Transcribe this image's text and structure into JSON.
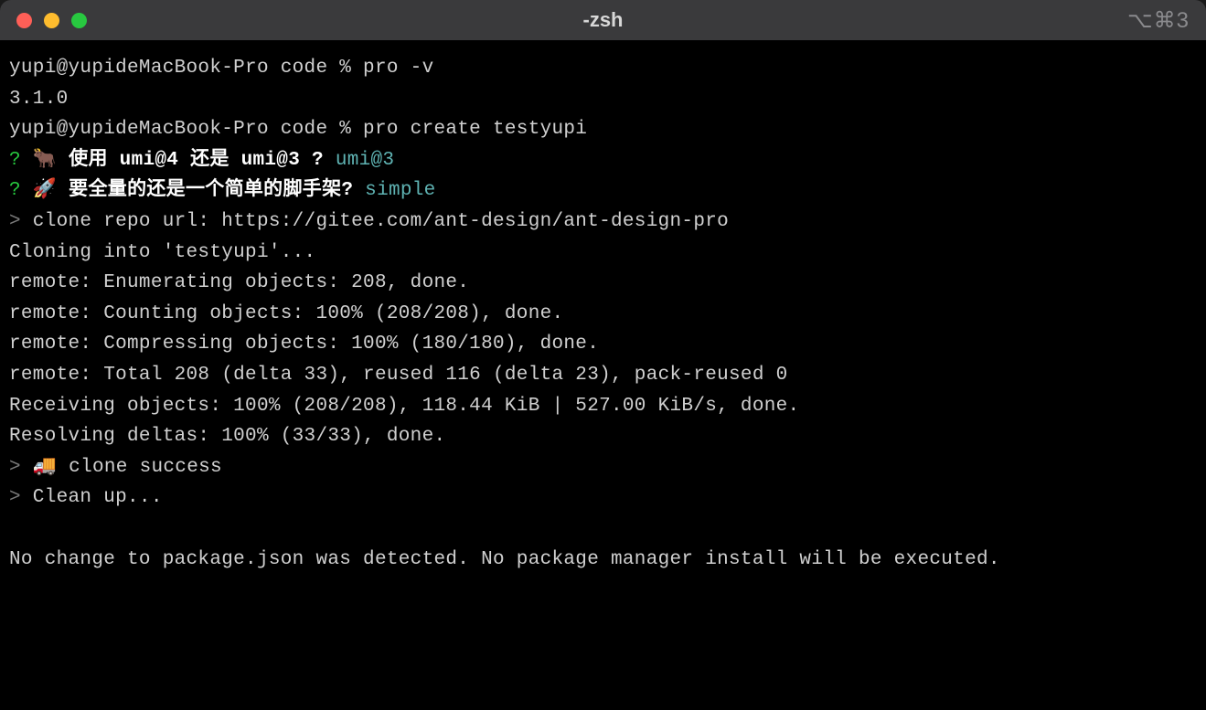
{
  "titlebar": {
    "title": "-zsh",
    "shortcut": "⌥⌘3"
  },
  "lines": {
    "l0": "yupi@yupideMacBook-Pro code % pro -v",
    "l1": "3.1.0",
    "l2": "yupi@yupideMacBook-Pro code % pro create testyupi",
    "q1_mark": "?",
    "q1_emoji": "🐂",
    "q1_text": " 使用 umi@4 还是 umi@3 ? ",
    "q1_answer": "umi@3",
    "q2_mark": "?",
    "q2_emoji": "🚀",
    "q2_text": " 要全量的还是一个简单的脚手架? ",
    "q2_answer": "simple",
    "l5_gt": ">",
    "l5": " clone repo url: https://gitee.com/ant-design/ant-design-pro",
    "l6": "Cloning into 'testyupi'...",
    "l7": "remote: Enumerating objects: 208, done.",
    "l8": "remote: Counting objects: 100% (208/208), done.",
    "l9": "remote: Compressing objects: 100% (180/180), done.",
    "l10": "remote: Total 208 (delta 33), reused 116 (delta 23), pack-reused 0",
    "l11": "Receiving objects: 100% (208/208), 118.44 KiB | 527.00 KiB/s, done.",
    "l12": "Resolving deltas: 100% (33/33), done.",
    "l13_gt": ">",
    "l13_emoji": "🚚",
    "l13": " clone success",
    "l14_gt": ">",
    "l14": " Clean up...",
    "l15": "No change to package.json was detected. No package manager install will be executed."
  }
}
